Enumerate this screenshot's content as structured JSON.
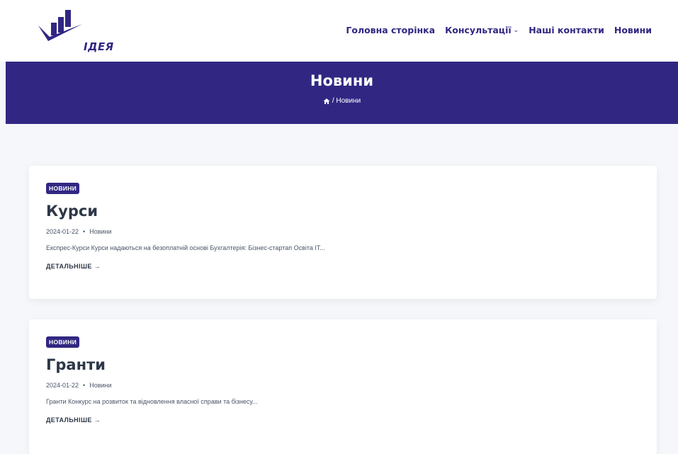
{
  "header": {
    "logo_text": "ІДЕЯ",
    "nav": [
      {
        "label": "Головна сторінка"
      },
      {
        "label": "Консультації",
        "has_dropdown": true
      },
      {
        "label": "Наші контакти"
      },
      {
        "label": "Новини"
      }
    ]
  },
  "banner": {
    "title": "Новини",
    "breadcrumb": "/ Новини"
  },
  "posts": [
    {
      "badge": "НОВИНИ",
      "title": "Курси",
      "date": "2024-01-22",
      "category": "Новини",
      "excerpt": "Експрес-Курси Курси надаються на безоплатній основі Бухгалтерія: Бізнес-стартап Освіта IT...",
      "more": "ДЕТАЛЬНІШЕ →"
    },
    {
      "badge": "НОВИНИ",
      "title": "Гранти",
      "date": "2024-01-22",
      "category": "Новини",
      "excerpt": "Гранти Конкурс на розвиток та відновлення власної справи та бізнесу...",
      "more": "ДЕТАЛЬНІШЕ →"
    }
  ],
  "colors": {
    "brand": "#312783",
    "page_bg": "#f5f7fa",
    "text": "#2d3748"
  },
  "icons": [
    "logo-icon",
    "home-icon",
    "chevron-down-icon"
  ]
}
